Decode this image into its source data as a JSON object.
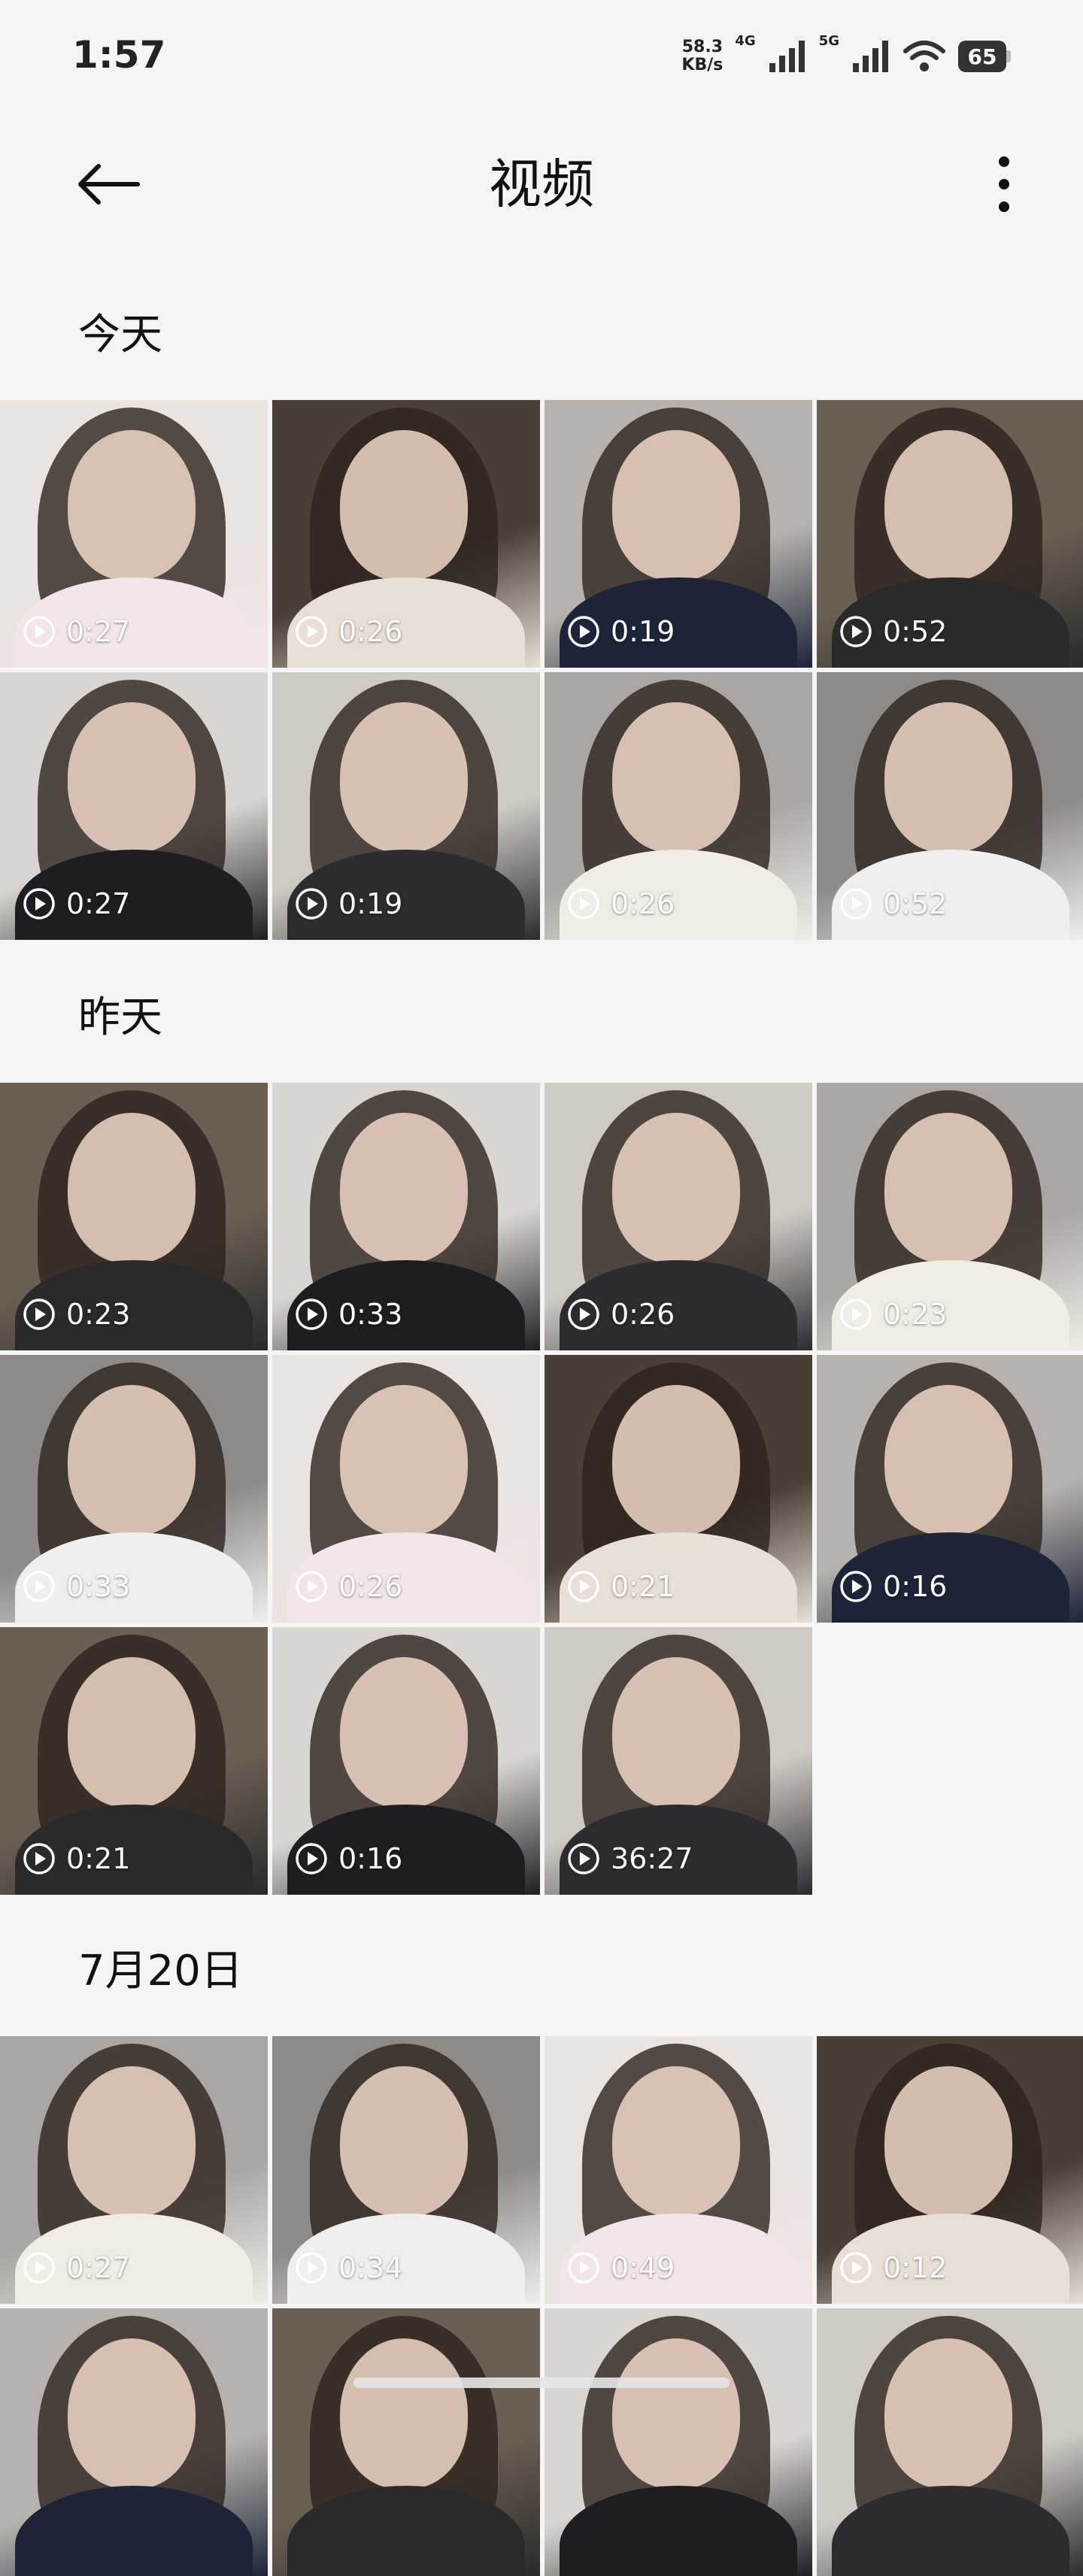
{
  "status": {
    "time": "1:57",
    "net_speed_value": "58.3",
    "net_speed_unit": "KB/s",
    "net1": "4G",
    "net2": "5G",
    "battery": "65"
  },
  "header": {
    "title": "视频",
    "back_icon": "back-arrow-icon",
    "more_icon": "more-vertical-icon"
  },
  "sections": [
    {
      "title": "今天",
      "durations": [
        "0:27",
        "0:26",
        "0:19",
        "0:52",
        "0:27",
        "0:19",
        "0:26",
        "0:52"
      ]
    },
    {
      "title": "昨天",
      "durations": [
        "0:23",
        "0:33",
        "0:26",
        "0:23",
        "0:33",
        "0:26",
        "0:21",
        "0:16",
        "0:21",
        "0:16",
        "36:27"
      ]
    },
    {
      "title": "7月20日",
      "durations": [
        "0:27",
        "0:34",
        "0:49",
        "0:12",
        "",
        "",
        "",
        ""
      ]
    }
  ]
}
